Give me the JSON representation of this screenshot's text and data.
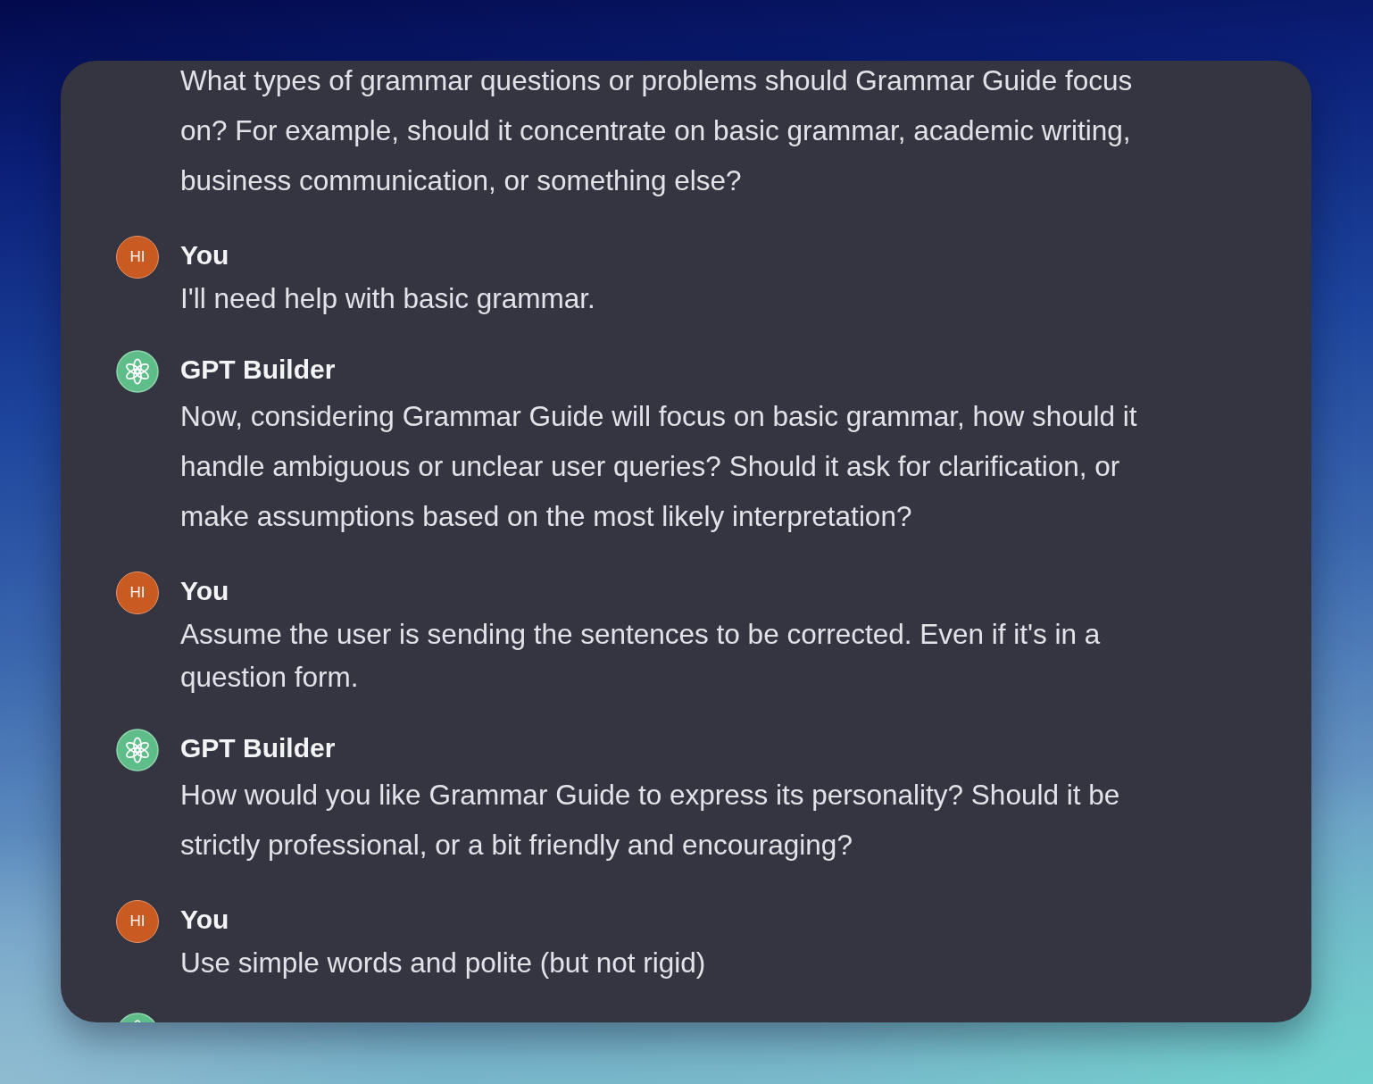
{
  "chat": {
    "messages": [
      {
        "kind": "assistant",
        "text": "What types of grammar questions or problems should Grammar Guide focus\non? For example, should it concentrate on basic grammar, academic writing,\nbusiness communication, or something else?"
      },
      {
        "kind": "user",
        "author": "You",
        "initials": "HI",
        "text": "I'll need help with basic grammar."
      },
      {
        "kind": "assistant",
        "author": "GPT Builder",
        "text": "Now, considering Grammar Guide will focus on basic grammar, how should it\nhandle ambiguous or unclear user queries? Should it ask for clarification, or\nmake assumptions based on the most likely interpretation?"
      },
      {
        "kind": "user",
        "author": "You",
        "initials": "HI",
        "text": "Assume the user is sending the sentences to be corrected. Even if it's in a\nquestion form."
      },
      {
        "kind": "assistant",
        "author": "GPT Builder",
        "text": "How would you like Grammar Guide to express its personality? Should it be\nstrictly professional, or a bit friendly and encouraging?"
      },
      {
        "kind": "user",
        "author": "You",
        "initials": "HI",
        "text": "Use simple words and polite (but not rigid)"
      },
      {
        "kind": "assistant",
        "clipped": true
      }
    ]
  }
}
